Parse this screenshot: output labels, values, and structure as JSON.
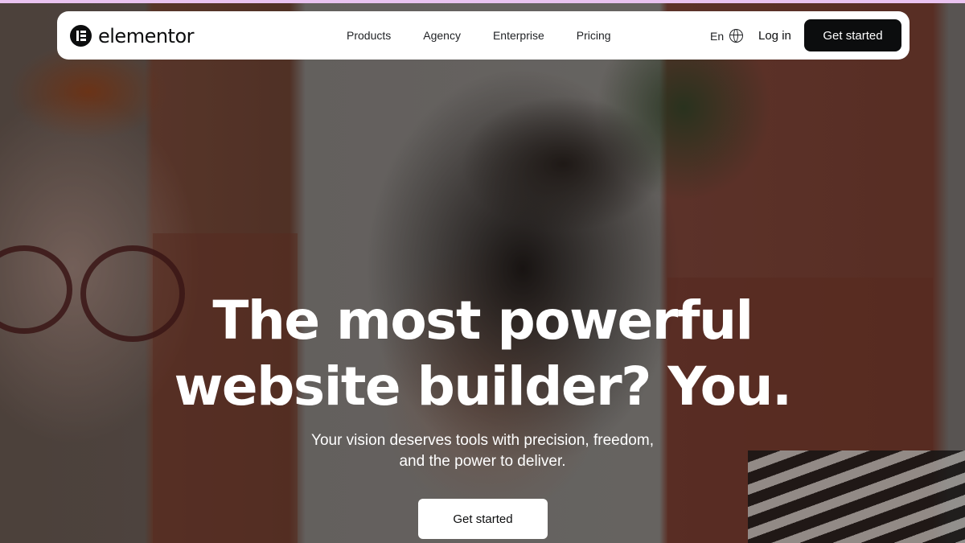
{
  "brand": {
    "name": "elementor"
  },
  "nav": {
    "links": [
      "Products",
      "Agency",
      "Enterprise",
      "Pricing"
    ],
    "language": "En",
    "login_label": "Log in",
    "cta_label": "Get started"
  },
  "hero": {
    "headline_line1": "The most powerful",
    "headline_line2": "website builder? You.",
    "subtext_line1": "Your vision deserves tools with precision, freedom,",
    "subtext_line2": "and the power to deliver.",
    "cta_label": "Get started"
  },
  "icons": [
    "elementor-logo-icon",
    "globe-icon"
  ],
  "colors": {
    "brand_dark": "#0c0d0e",
    "accent_strip": "#e9c3f0",
    "white": "#ffffff"
  }
}
